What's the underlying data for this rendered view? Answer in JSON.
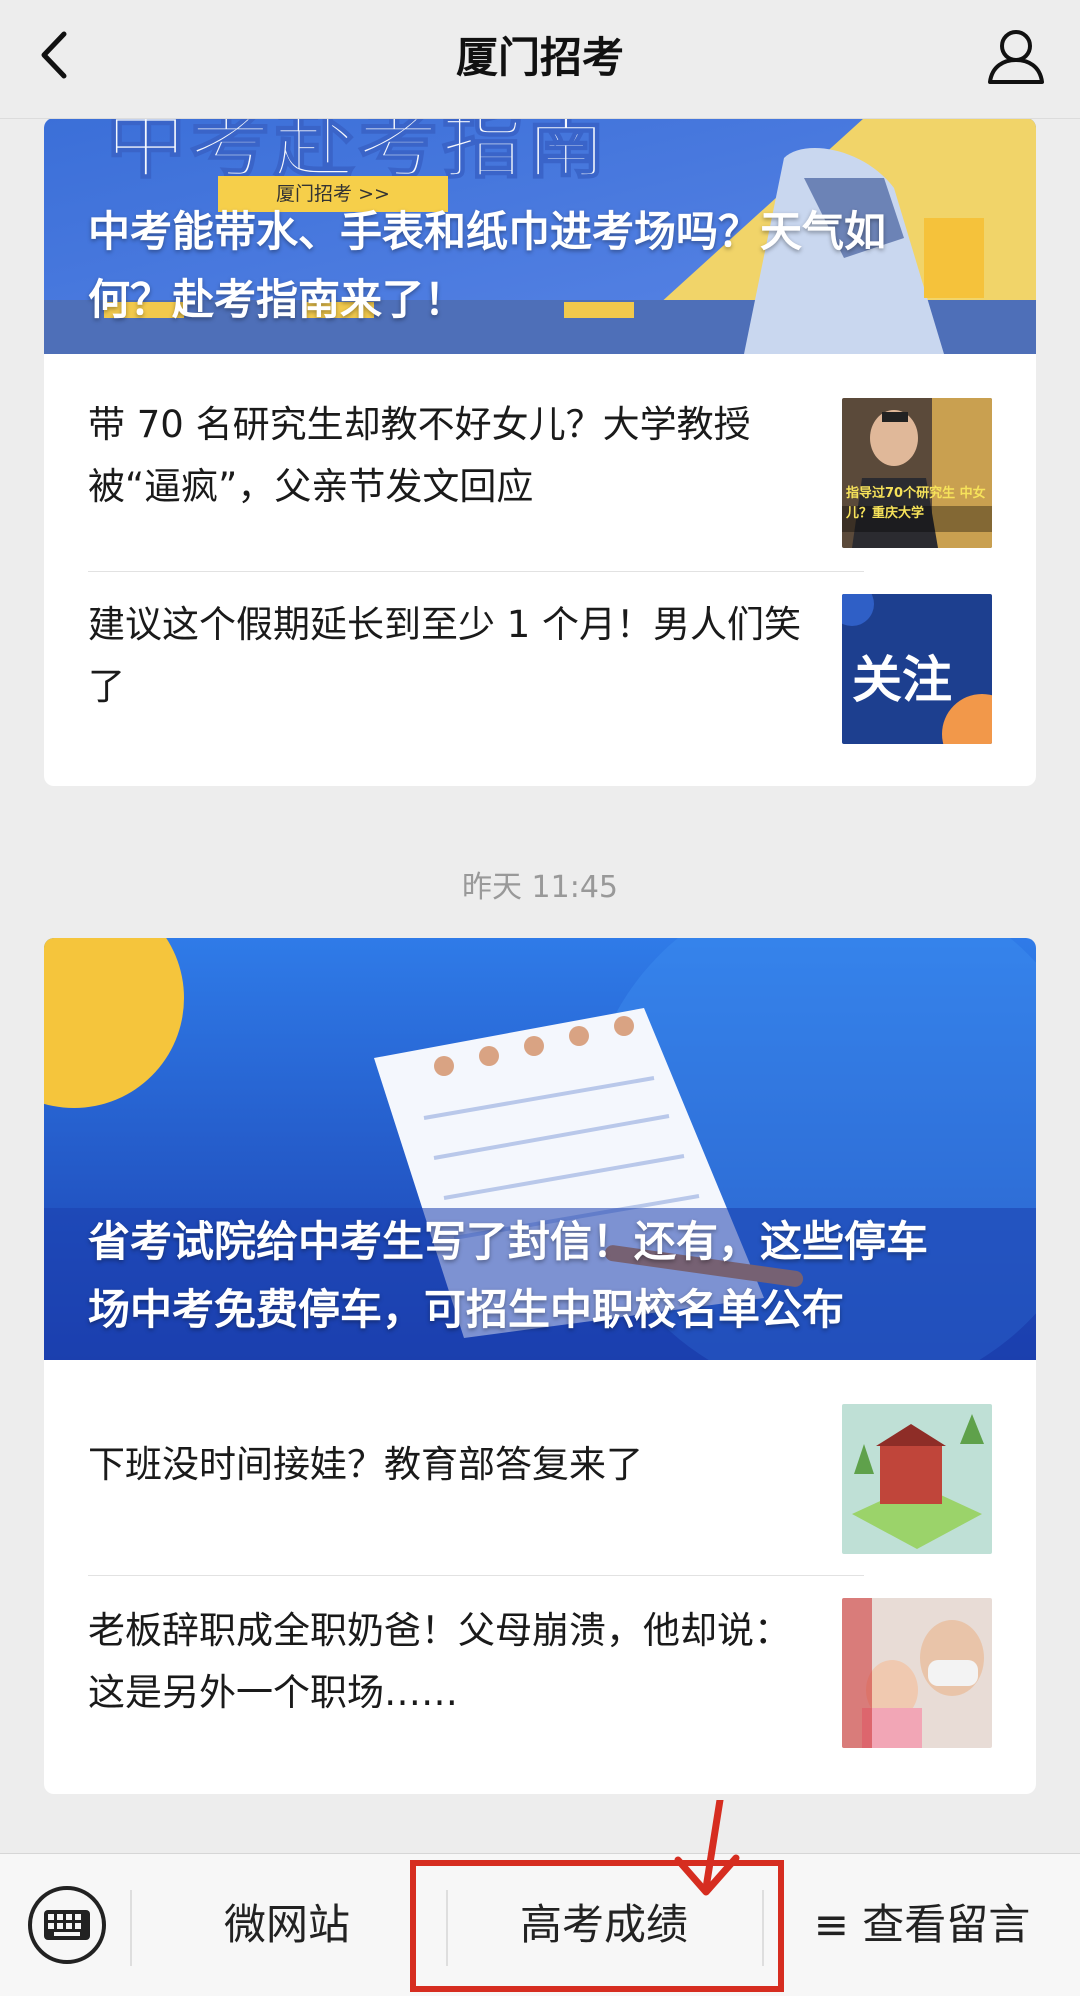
{
  "header": {
    "title": "厦门招考"
  },
  "feed": {
    "card1": {
      "hero_banner_text": "中考赴考指南",
      "hero_tag": "厦门招考 >>",
      "hero_title": "中考能带水、手表和纸巾进考场吗？天气如何？赴考指南来了！",
      "items": [
        {
          "title": "带 70 名研究生却教不好女儿？大学教授被“逼疯”，父亲节发文回应",
          "thumb_caption": "指导过70个研究生 中女儿？重庆大学"
        },
        {
          "title": " 建议这个假期延长到至少 1 个月！男人们笑了",
          "thumb_caption": "关注"
        }
      ]
    },
    "timestamp": "昨天 11:45",
    "card2": {
      "hero_title": "省考试院给中考生写了封信！还有，这些停车场中考免费停车，可招生中职校名单公布",
      "items": [
        {
          "title": "下班没时间接娃？教育部答复来了"
        },
        {
          "title": "老板辞职成全职奶爸！父母崩溃，他却说：这是另外一个职场……"
        }
      ]
    }
  },
  "bottom_menu": {
    "items": [
      "微网站",
      "高考成绩",
      "≡ 查看留言"
    ]
  },
  "colors": {
    "background": "#ededed",
    "highlight": "#d62d20",
    "hero2_blue": "#1f5fd6"
  }
}
